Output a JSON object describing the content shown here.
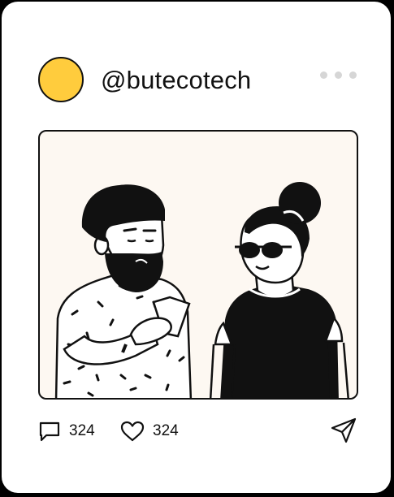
{
  "post": {
    "username": "@butecotech",
    "avatar_color": "#FFCC3D",
    "menu_icon": "more-horizontal-icon"
  },
  "image": {
    "background": "#FDF8F2"
  },
  "actions": {
    "comment_icon": "comment-icon",
    "comment_count": "324",
    "like_icon": "heart-icon",
    "like_count": "324",
    "share_icon": "send-icon"
  }
}
